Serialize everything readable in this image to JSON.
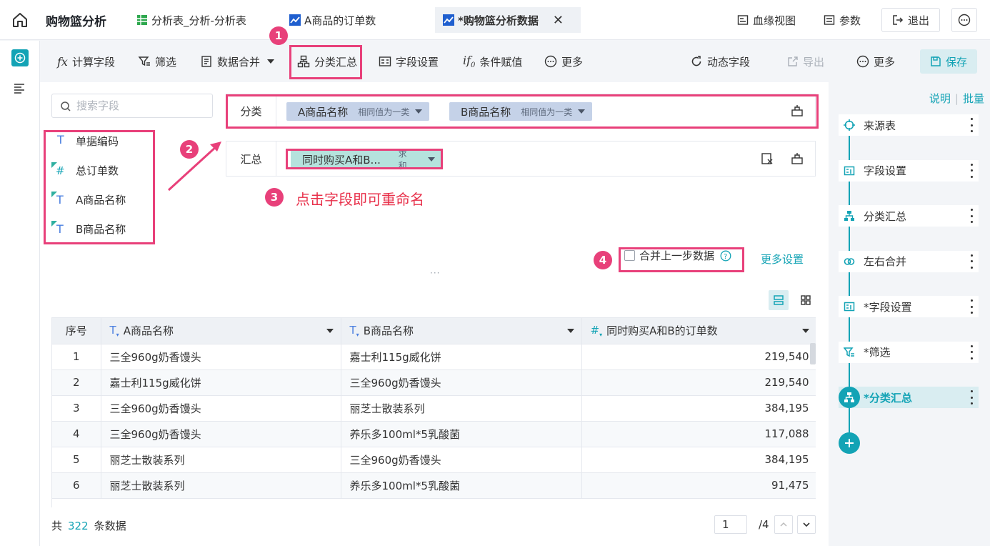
{
  "topbar": {
    "app_title": "购物篮分析",
    "tabs": [
      {
        "label": "分析表_分析-分析表",
        "icon": "table-icon"
      },
      {
        "label": "A商品的订单数",
        "icon": "chart-icon"
      },
      {
        "label": "*购物篮分析数据",
        "icon": "chart-icon",
        "active": true
      }
    ],
    "lineage_label": "血缘视图",
    "params_label": "参数",
    "exit_label": "退出"
  },
  "toolbar": {
    "calc_field": "计算字段",
    "filter": "筛选",
    "merge": "数据合并",
    "group_summary": "分类汇总",
    "field_settings": "字段设置",
    "conditional_assign": "条件赋值",
    "more": "更多",
    "dynamic_field": "动态字段",
    "export": "导出",
    "more2": "更多",
    "save": "保存"
  },
  "search": {
    "placeholder": "搜索字段"
  },
  "fields": [
    {
      "label": "单据编码",
      "type": "text"
    },
    {
      "label": "总订单数",
      "type": "number"
    },
    {
      "label": "A商品名称",
      "type": "text"
    },
    {
      "label": "B商品名称",
      "type": "text"
    }
  ],
  "classify": {
    "label": "分类",
    "chips": [
      {
        "name": "A商品名称",
        "mode": "相同值为一类"
      },
      {
        "name": "B商品名称",
        "mode": "相同值为一类"
      }
    ]
  },
  "summary": {
    "label": "汇总",
    "chip": {
      "name": "同时购买A和B...",
      "agg": "求和"
    }
  },
  "annotations": {
    "b1": "1",
    "b2": "2",
    "b3": "3",
    "b4": "4",
    "rename_tip": "点击字段即可重命名"
  },
  "merge_prev": "合并上一步数据",
  "more_settings": "更多设置",
  "table": {
    "headers": [
      "序号",
      "A商品名称",
      "B商品名称",
      "同时购买A和B的订单数"
    ],
    "rows": [
      [
        "1",
        "三全960g奶香馒头",
        "嘉士利115g威化饼",
        "219,540"
      ],
      [
        "2",
        "嘉士利115g威化饼",
        "三全960g奶香馒头",
        "219,540"
      ],
      [
        "3",
        "三全960g奶香馒头",
        "丽芝士散装系列",
        "384,195"
      ],
      [
        "4",
        "三全960g奶香馒头",
        "养乐多100ml*5乳酸菌",
        "117,088"
      ],
      [
        "5",
        "丽芝士散装系列",
        "三全960g奶香馒头",
        "384,195"
      ],
      [
        "6",
        "丽芝士散装系列",
        "养乐多100ml*5乳酸菌",
        "91,475"
      ]
    ]
  },
  "footer": {
    "prefix": "共",
    "count": "322",
    "suffix": "条数据",
    "page": "1",
    "total_pages": "/4"
  },
  "right_panel": {
    "explain": "说明",
    "sep": "|",
    "batch": "批量",
    "steps": [
      {
        "label": "来源表",
        "icon": "source-icon"
      },
      {
        "label": "字段设置",
        "icon": "field-settings-icon"
      },
      {
        "label": "分类汇总",
        "icon": "group-icon"
      },
      {
        "label": "左右合并",
        "icon": "join-icon"
      },
      {
        "label": "*字段设置",
        "icon": "field-settings-icon"
      },
      {
        "label": "*筛选",
        "icon": "filter-icon"
      },
      {
        "label": "*分类汇总",
        "icon": "group-icon",
        "active": true
      }
    ]
  },
  "colors": {
    "accent": "#13a3b5",
    "annotation": "#e8407a",
    "chip_blue": "#c5d2e8",
    "chip_green": "#b5e2dd"
  }
}
